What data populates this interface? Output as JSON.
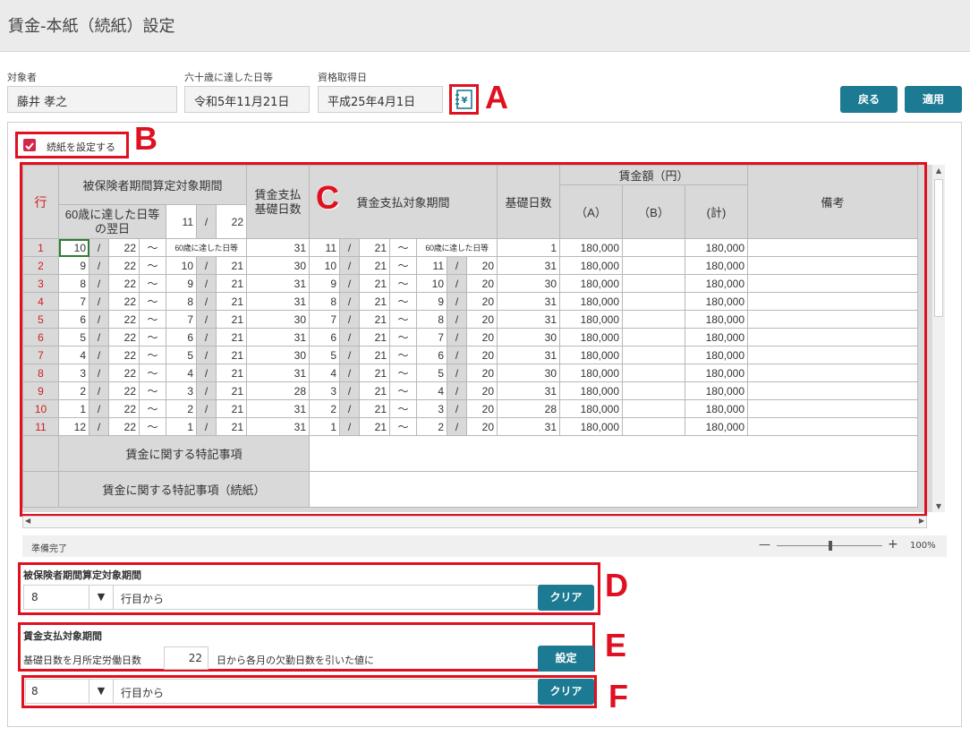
{
  "window": {
    "title": "賃金-本紙（続紙）設定"
  },
  "header": {
    "target_label": "対象者",
    "target_value": "藤井 孝之",
    "age60_label": "六十歳に達した日等",
    "age60_value": "令和5年11月21日",
    "qualification_label": "資格取得日",
    "qualification_value": "平成25年4月1日",
    "back_label": "戻る",
    "apply_label": "適用"
  },
  "annotations": {
    "a": "A",
    "b": "B",
    "c": "C",
    "d": "D",
    "e": "E",
    "f": "F"
  },
  "checkbox": {
    "label": "続紙を設定する",
    "checked": true
  },
  "grid": {
    "h_row": "行",
    "h_period": "被保険者期間算定対象期間",
    "h_age60_next": "60歳に達した日等の翌日",
    "h_age60_month": "11",
    "h_age60_day": "22",
    "h_pay_days": "賃金支払基礎日数",
    "h_pay_period": "賃金支払対象期間",
    "h_base_days": "基礎日数",
    "h_wage": "賃金額（円）",
    "h_a": "（A）",
    "h_b": "（B）",
    "h_total": "(計)",
    "h_notes": "備考",
    "slash": "/",
    "tilde": "〜",
    "special_label": "賃金に関する特記事項",
    "special_cont_label": "賃金に関する特記事項（続紙）",
    "rows": [
      {
        "n": "1",
        "m1": "10",
        "d1": "22",
        "m2": "60歳に達した日等",
        "d2": "",
        "days": "31",
        "pm1": "11",
        "pd1": "21",
        "pm2": "60歳に達した日等",
        "pd2": "",
        "base": "1",
        "a": "180,000",
        "b": "",
        "t": "180,000"
      },
      {
        "n": "2",
        "m1": "9",
        "d1": "22",
        "m2": "10",
        "d2": "21",
        "days": "30",
        "pm1": "10",
        "pd1": "21",
        "pm2": "11",
        "pd2": "20",
        "base": "31",
        "a": "180,000",
        "b": "",
        "t": "180,000"
      },
      {
        "n": "3",
        "m1": "8",
        "d1": "22",
        "m2": "9",
        "d2": "21",
        "days": "31",
        "pm1": "9",
        "pd1": "21",
        "pm2": "10",
        "pd2": "20",
        "base": "30",
        "a": "180,000",
        "b": "",
        "t": "180,000"
      },
      {
        "n": "4",
        "m1": "7",
        "d1": "22",
        "m2": "8",
        "d2": "21",
        "days": "31",
        "pm1": "8",
        "pd1": "21",
        "pm2": "9",
        "pd2": "20",
        "base": "31",
        "a": "180,000",
        "b": "",
        "t": "180,000"
      },
      {
        "n": "5",
        "m1": "6",
        "d1": "22",
        "m2": "7",
        "d2": "21",
        "days": "30",
        "pm1": "7",
        "pd1": "21",
        "pm2": "8",
        "pd2": "20",
        "base": "31",
        "a": "180,000",
        "b": "",
        "t": "180,000"
      },
      {
        "n": "6",
        "m1": "5",
        "d1": "22",
        "m2": "6",
        "d2": "21",
        "days": "31",
        "pm1": "6",
        "pd1": "21",
        "pm2": "7",
        "pd2": "20",
        "base": "30",
        "a": "180,000",
        "b": "",
        "t": "180,000"
      },
      {
        "n": "7",
        "m1": "4",
        "d1": "22",
        "m2": "5",
        "d2": "21",
        "days": "30",
        "pm1": "5",
        "pd1": "21",
        "pm2": "6",
        "pd2": "20",
        "base": "31",
        "a": "180,000",
        "b": "",
        "t": "180,000"
      },
      {
        "n": "8",
        "m1": "3",
        "d1": "22",
        "m2": "4",
        "d2": "21",
        "days": "31",
        "pm1": "4",
        "pd1": "21",
        "pm2": "5",
        "pd2": "20",
        "base": "30",
        "a": "180,000",
        "b": "",
        "t": "180,000"
      },
      {
        "n": "9",
        "m1": "2",
        "d1": "22",
        "m2": "3",
        "d2": "21",
        "days": "28",
        "pm1": "3",
        "pd1": "21",
        "pm2": "4",
        "pd2": "20",
        "base": "31",
        "a": "180,000",
        "b": "",
        "t": "180,000"
      },
      {
        "n": "10",
        "m1": "1",
        "d1": "22",
        "m2": "2",
        "d2": "21",
        "days": "31",
        "pm1": "2",
        "pd1": "21",
        "pm2": "3",
        "pd2": "20",
        "base": "28",
        "a": "180,000",
        "b": "",
        "t": "180,000"
      },
      {
        "n": "11",
        "m1": "12",
        "d1": "22",
        "m2": "1",
        "d2": "21",
        "days": "31",
        "pm1": "1",
        "pd1": "21",
        "pm2": "2",
        "pd2": "20",
        "base": "31",
        "a": "180,000",
        "b": "",
        "t": "180,000"
      }
    ]
  },
  "status": {
    "text": "準備完了",
    "zoom": "100%",
    "minus": "—",
    "plus": "+"
  },
  "section_d": {
    "title": "被保険者期間算定対象期間",
    "select_value": "8",
    "suffix": "行目から",
    "clear_label": "クリア"
  },
  "section_e": {
    "title": "賃金支払対象期間",
    "prefix": "基礎日数を月所定労働日数",
    "days_value": "22",
    "suffix": "日から各月の欠勤日数を引いた値に",
    "set_label": "設定"
  },
  "section_f": {
    "select_value": "8",
    "suffix": "行目から",
    "clear_label": "クリア"
  },
  "icons": {
    "dropdown": "▼",
    "scroll_up": "▲",
    "scroll_down": "▼",
    "scroll_left": "◀",
    "scroll_right": "▶"
  },
  "colors": {
    "accent": "#1c7a92",
    "annotation_red": "#e01020",
    "row_number": "#d02020"
  }
}
